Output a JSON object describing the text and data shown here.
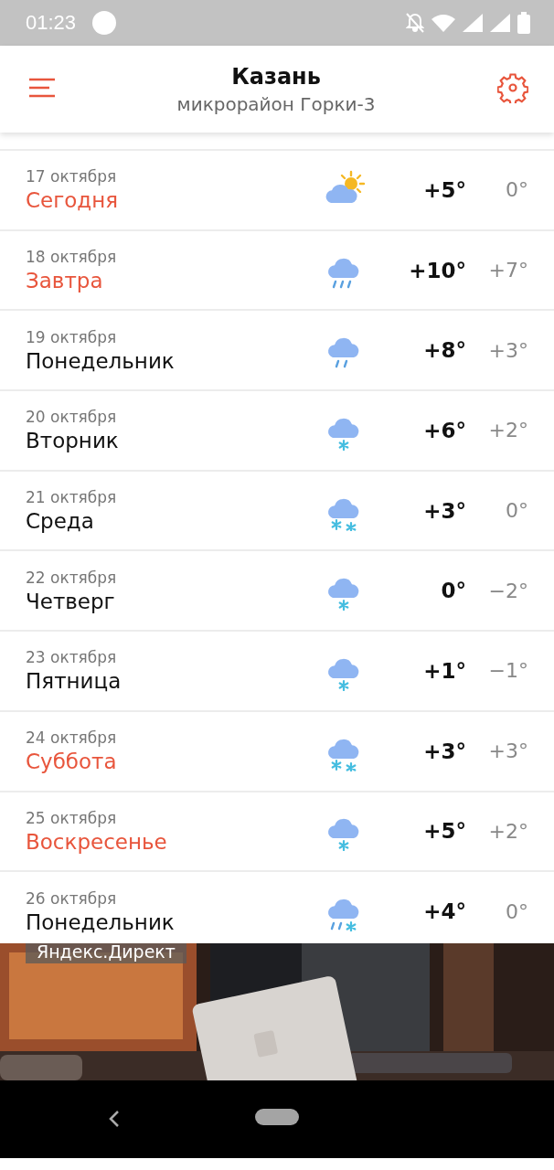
{
  "status_bar": {
    "time": "01:23"
  },
  "header": {
    "city": "Казань",
    "district": "микрорайон Горки-3"
  },
  "days": [
    {
      "date": "17 октября",
      "day": "Сегодня",
      "highlighted": true,
      "kind": "partly-cloudy",
      "day_temp": "+5°",
      "night_temp": "0°"
    },
    {
      "date": "18 октября",
      "day": "Завтра",
      "highlighted": true,
      "kind": "rain-heavy",
      "day_temp": "+10°",
      "night_temp": "+7°"
    },
    {
      "date": "19 октября",
      "day": "Понедельник",
      "highlighted": false,
      "kind": "rain",
      "day_temp": "+8°",
      "night_temp": "+3°"
    },
    {
      "date": "20 октября",
      "day": "Вторник",
      "highlighted": false,
      "kind": "snow",
      "day_temp": "+6°",
      "night_temp": "+2°"
    },
    {
      "date": "21 октября",
      "day": "Среда",
      "highlighted": false,
      "kind": "snow-heavy",
      "day_temp": "+3°",
      "night_temp": "0°"
    },
    {
      "date": "22 октября",
      "day": "Четверг",
      "highlighted": false,
      "kind": "snow",
      "day_temp": "0°",
      "night_temp": "−2°"
    },
    {
      "date": "23 октября",
      "day": "Пятница",
      "highlighted": false,
      "kind": "snow",
      "day_temp": "+1°",
      "night_temp": "−1°"
    },
    {
      "date": "24 октября",
      "day": "Суббота",
      "highlighted": true,
      "kind": "snow-heavy",
      "day_temp": "+3°",
      "night_temp": "+3°"
    },
    {
      "date": "25 октября",
      "day": "Воскресенье",
      "highlighted": true,
      "kind": "snow",
      "day_temp": "+5°",
      "night_temp": "+2°"
    },
    {
      "date": "26 октября",
      "day": "Понедельник",
      "highlighted": false,
      "kind": "sleet",
      "day_temp": "+4°",
      "night_temp": "0°"
    }
  ],
  "ad": {
    "label": "Яндекс.Директ",
    "kind": "picture"
  }
}
